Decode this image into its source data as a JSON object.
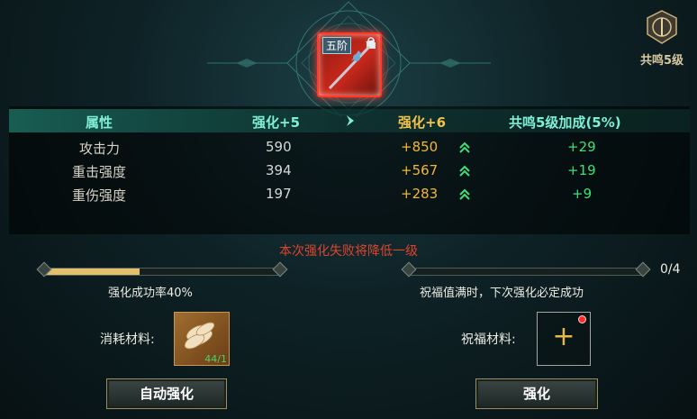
{
  "item": {
    "tier": "五阶",
    "locked": true,
    "icon": "spear-weapon-icon"
  },
  "resonance": {
    "label": "共鸣5级"
  },
  "table": {
    "headers": {
      "attr": "属性",
      "current": "强化+5",
      "next": "强化+6",
      "bonus": "共鸣5级加成(5%)"
    },
    "rows": [
      {
        "name": "攻击力",
        "current": "590",
        "next": "+850",
        "bonus": "+29"
      },
      {
        "name": "重击强度",
        "current": "394",
        "next": "+567",
        "bonus": "+19"
      },
      {
        "name": "重伤强度",
        "current": "197",
        "next": "+283",
        "bonus": "+9"
      }
    ]
  },
  "warning": "本次强化失败将降低一级",
  "success": {
    "label": "强化成功率40%",
    "value": 0.4
  },
  "blessing": {
    "progress": "0/4",
    "value": 0.0,
    "hint": "祝福值满时，下次强化必定成功"
  },
  "materials": {
    "consume_label": "消耗材料:",
    "count": "44/1",
    "bless_label": "祝福材料:"
  },
  "buttons": {
    "auto": "自动强化",
    "enhance": "强化"
  },
  "colors": {
    "accent": "#7ff0d6",
    "next_value": "#f2b63a",
    "bonus": "#3fe07a",
    "warning": "#e0442e"
  }
}
